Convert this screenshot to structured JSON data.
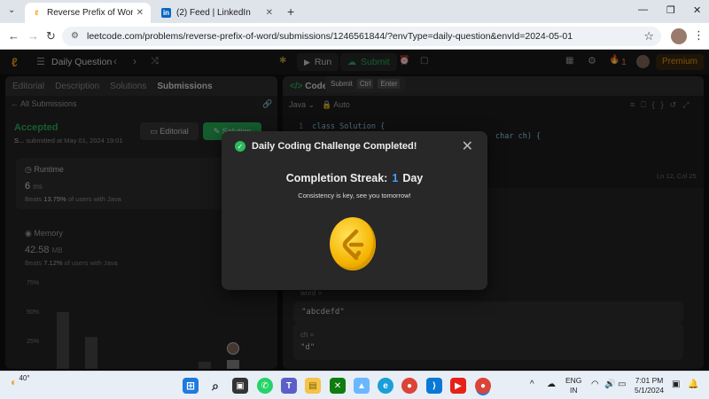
{
  "browser": {
    "tabs": [
      {
        "title": "Reverse Prefix of Word - LeetCo",
        "favicon": "LC"
      },
      {
        "title": "(2) Feed | LinkedIn",
        "favicon": "in"
      }
    ],
    "url": "leetcode.com/problems/reverse-prefix-of-word/submissions/1246561844/?envType=daily-question&envId=2024-05-01"
  },
  "app": {
    "daily": "Daily Question",
    "run": "Run",
    "submit": "Submit",
    "streak_count": "1",
    "premium": "Premium",
    "left_tabs": [
      "Editorial",
      "Description",
      "Solutions",
      "Submissions"
    ],
    "all_submissions": "All Submissions",
    "accepted": "Accepted",
    "submitted_by": "S...",
    "submitted_at": "submitted at May 01, 2024 19:01",
    "editorial_btn": "Editorial",
    "solution_btn": "Solution",
    "runtime_label": "Runtime",
    "runtime_value": "6",
    "runtime_unit": "ms",
    "runtime_beats_prefix": "Beats",
    "runtime_beats": "13.75%",
    "runtime_beats_suffix": "of users with Java",
    "memory_label": "Memory",
    "memory_value": "42.58",
    "memory_unit": "MB",
    "memory_beats_prefix": "Beats",
    "memory_beats": "7.12%",
    "memory_beats_suffix": "of users with Java",
    "y_ticks": [
      "75%",
      "50%",
      "25%"
    ],
    "code_title": "Code",
    "tooltip_submit": "Submit",
    "tooltip_key1": "Ctrl",
    "tooltip_key2": "Enter",
    "language": "Java",
    "auto": "Auto",
    "line1": "class Solution {",
    "line2": "char ch) {",
    "cursor_pos": "Ln 12, Col 25",
    "word_label": "word =",
    "word_value": "\"abcdefd\"",
    "ch_label": "ch =",
    "ch_value": "\"d\""
  },
  "modal": {
    "title": "Daily Coding Challenge Completed!",
    "streak_prefix": "Completion Streak:",
    "streak_num": "1",
    "streak_unit": "Day",
    "subtitle": "Consistency is key, see you tomorrow!"
  },
  "taskbar": {
    "weather": "40°",
    "lang1": "ENG",
    "lang2": "IN",
    "time": "7:01 PM",
    "date": "5/1/2024"
  }
}
